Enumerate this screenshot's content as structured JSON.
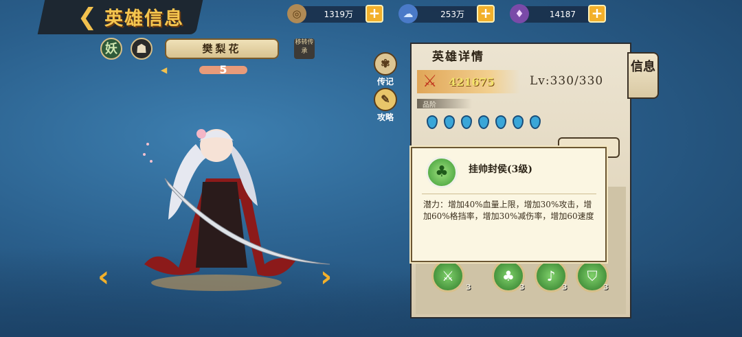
{
  "header": {
    "title": "英雄信息"
  },
  "currencies": [
    {
      "icon": "copper-coin-icon",
      "value": "1319万"
    },
    {
      "icon": "blue-spirit-icon",
      "value": "253万"
    },
    {
      "icon": "purple-soul-icon",
      "value": "14187"
    }
  ],
  "hero": {
    "faction_label": "妖",
    "name": "樊梨花",
    "star_count": "5",
    "side_tag": "移转传承"
  },
  "side_buttons": {
    "biography": "传记",
    "strategy": "攻略"
  },
  "detail_panel": {
    "title": "英雄详情",
    "power": "421675",
    "level": "Lv:330/330",
    "grade_label": "品阶",
    "gem_count": 7,
    "info_tab": "信息"
  },
  "skills": [
    {
      "icon": "sword-skill-icon",
      "count": "3"
    },
    {
      "icon": "frog-skill-icon",
      "count": "3"
    },
    {
      "icon": "horn-skill-icon",
      "count": "3"
    },
    {
      "icon": "shield-skill-icon",
      "count": "3"
    }
  ],
  "tooltip": {
    "title": "挂帅封侯(3级)",
    "description": "潜力：增加40%血量上限，增加30%攻击，增加60%格挡率，增加30%减伤率，增加60速度"
  },
  "colors": {
    "accent_gold": "#f2b02b",
    "panel_bg": "#ece4d1",
    "background_blue": "#2a5f8c"
  }
}
